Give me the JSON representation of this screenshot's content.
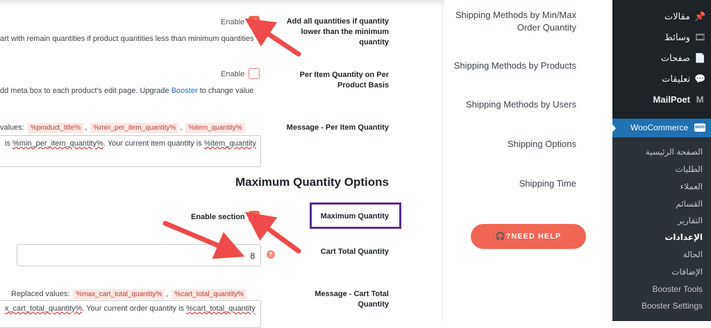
{
  "rows": {
    "add_quantities": {
      "label": "Add all quantities if quantity lower than the minimum quantity",
      "enable_text": "Enable",
      "checked": true,
      "description": "art with remain quantities if product quantities less than minimum quantities"
    },
    "per_item": {
      "label": "Per Item Quantity on Per Product Basis",
      "enable_text": "Enable",
      "checked": false,
      "description_pre": "dd meta box to each product's edit page. Upgrade ",
      "description_link": "Booster",
      "description_post": " to change value"
    },
    "message_per_item": {
      "label": "Message - Per Item Quantity",
      "replaced_label": "values:",
      "tags": [
        "%product_title%",
        "%min_per_item_quantity%",
        "%item_quantity%"
      ],
      "sep": ",",
      "text_pre": "is ",
      "text_squig1": "%min_per_item_quantity%",
      "text_mid": ". Your current item quantity is ",
      "text_squig2": "%item_quantity"
    }
  },
  "section_title": "Maximum Quantity Options",
  "max_rows": {
    "max_quantity": {
      "label": "Maximum Quantity",
      "enable_text": "Enable section",
      "checked": true
    },
    "cart_total": {
      "label": "Cart Total Quantity",
      "value": "8",
      "help": "?"
    },
    "message_cart_total": {
      "label": "Message - Cart Total Quantity",
      "replaced_label": "Replaced values:",
      "tags": [
        "%max_cart_total_quantity%",
        "%cart_total_quantity%"
      ],
      "sep": ",",
      "text_squig1": "x_cart_total_quantity%",
      "text_mid": ". Your current order quantity is ",
      "text_squig2": "%cart_total_quantity"
    }
  },
  "submenu": [
    "Shipping Methods by Min/Max Order Quantity",
    "Shipping Methods by Products",
    "Shipping Methods by Users",
    "Shipping Options",
    "Shipping Time"
  ],
  "need_help": "NEED HELP",
  "sidebar": {
    "items": [
      {
        "label": "مقالات",
        "icon": "pin-icon",
        "glyph": "📌"
      },
      {
        "label": "وسائط",
        "icon": "media-icon",
        "glyph": "🎞"
      },
      {
        "label": "صفحات",
        "icon": "pages-icon",
        "glyph": "📄"
      },
      {
        "label": "تعليقات",
        "icon": "comments-icon",
        "glyph": "💬"
      },
      {
        "label": "MailPoet",
        "icon": "mailpoet-icon",
        "glyph": "M"
      }
    ],
    "woocommerce": {
      "label": "WooCommerce",
      "icon_text": "woo"
    },
    "sub_items": [
      {
        "label": "الصفحة الرئيسية",
        "current": false
      },
      {
        "label": "الطلبات",
        "current": false
      },
      {
        "label": "العملاء",
        "current": false
      },
      {
        "label": "القسائم",
        "current": false
      },
      {
        "label": "التقارير",
        "current": false
      },
      {
        "label": "الإعدادات",
        "current": true
      },
      {
        "label": "الحالة",
        "current": false
      },
      {
        "label": "الإضافات",
        "current": false
      },
      {
        "label": "Booster Tools",
        "current": false
      },
      {
        "label": "Booster Settings",
        "current": false
      }
    ]
  },
  "colors": {
    "accent": "#f06552",
    "arrow": "#ef4b4b",
    "highlight_box": "#5b2d8e",
    "wp_blue": "#2271b1",
    "sidebar": "#1d2327"
  }
}
